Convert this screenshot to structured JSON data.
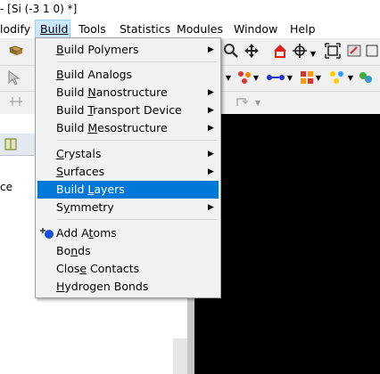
{
  "window": {
    "title": "- [Si (-3 1 0) *]"
  },
  "menubar": {
    "items": [
      {
        "label": "lodify",
        "active": false
      },
      {
        "label": "Build",
        "active": true
      },
      {
        "label": "Tools",
        "active": false
      },
      {
        "label": "Statistics",
        "active": false
      },
      {
        "label": "Modules",
        "active": false
      },
      {
        "label": "Window",
        "active": false
      },
      {
        "label": "Help",
        "active": false
      }
    ]
  },
  "left_panel": {
    "text": "ce"
  },
  "build_menu": {
    "items": [
      {
        "pre": "",
        "u": "B",
        "post": "uild Polymers",
        "submenu": true
      },
      {
        "pre": "",
        "u": "B",
        "post": "uild Analogs",
        "submenu": false
      },
      {
        "pre": "Build ",
        "u": "N",
        "post": "anostructure",
        "submenu": true
      },
      {
        "pre": "Build ",
        "u": "T",
        "post": "ransport Device",
        "submenu": true
      },
      {
        "pre": "Build ",
        "u": "M",
        "post": "esostructure",
        "submenu": true
      },
      {
        "pre": "",
        "u": "C",
        "post": "rystals",
        "submenu": true
      },
      {
        "pre": "",
        "u": "S",
        "post": "urfaces",
        "submenu": true
      },
      {
        "pre": "Build ",
        "u": "L",
        "post": "ayers",
        "submenu": false,
        "highlighted": true
      },
      {
        "pre": "S",
        "u": "y",
        "post": "mmetry",
        "submenu": true
      },
      {
        "pre": "Add A",
        "u": "t",
        "post": "oms",
        "submenu": false,
        "icon": "add-atom-icon"
      },
      {
        "pre": "Bo",
        "u": "n",
        "post": "ds",
        "submenu": false
      },
      {
        "pre": "Clos",
        "u": "e",
        "post": " Contacts",
        "submenu": false
      },
      {
        "pre": "",
        "u": "H",
        "post": "ydrogen Bonds",
        "submenu": false
      }
    ]
  },
  "icons": {
    "submenu_arrow": "▶",
    "toolbar": [
      "zoom-icon",
      "pan-icon",
      "home-icon",
      "center-icon",
      "fit-icon",
      "settings-icon",
      "tool-icon"
    ]
  },
  "colors": {
    "highlight": "#0078d7",
    "viewport": "#000000",
    "active_menu": "#cce8ff"
  }
}
